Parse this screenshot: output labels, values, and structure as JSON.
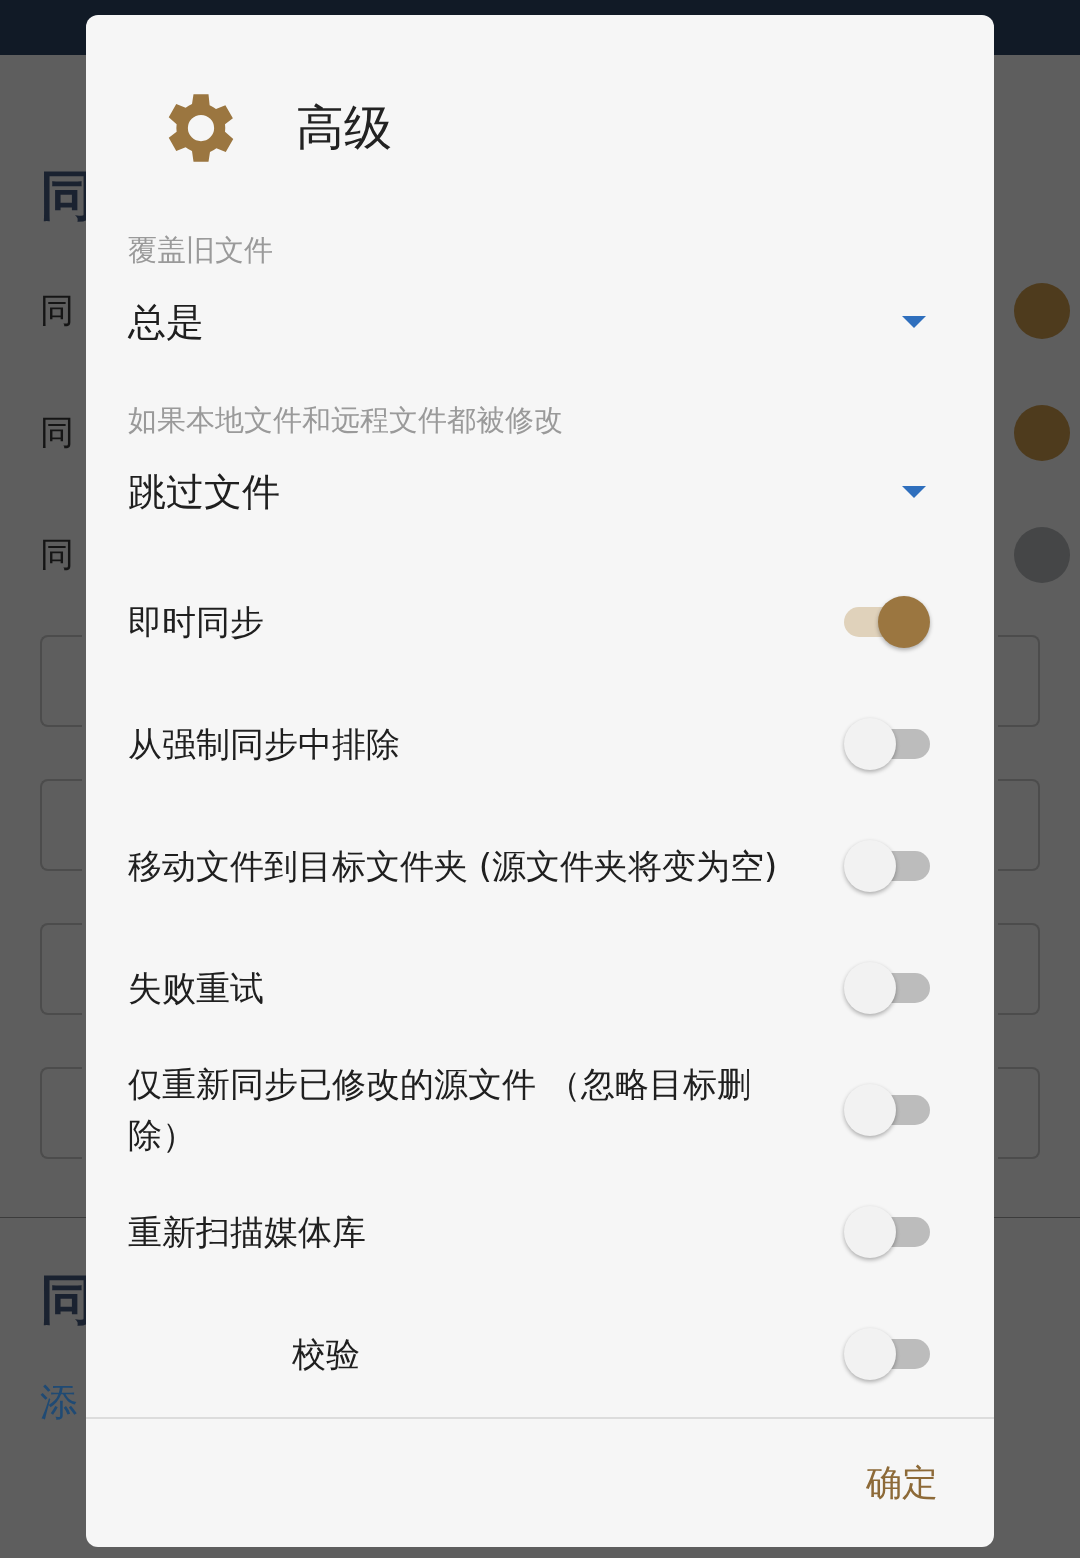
{
  "background": {
    "heading": "同",
    "labels": [
      "同",
      "同",
      "同"
    ],
    "switches": [
      {
        "on": true
      },
      {
        "on": true
      },
      {
        "on": false
      }
    ],
    "footer_heading": "同",
    "link": "添"
  },
  "dialog": {
    "title": "高级",
    "selects": [
      {
        "label": "覆盖旧文件",
        "value": "总是"
      },
      {
        "label": "如果本地文件和远程文件都被修改",
        "value": "跳过文件"
      }
    ],
    "toggles": [
      {
        "kind": "plain",
        "label": "即时同步",
        "on": true
      },
      {
        "kind": "plain",
        "label": "从强制同步中排除",
        "on": false
      },
      {
        "kind": "plain",
        "label": "移动文件到目标文件夹 (源文件夹将变为空)",
        "on": false
      },
      {
        "kind": "plain",
        "label": "失败重试",
        "on": false
      },
      {
        "kind": "plain",
        "label": "仅重新同步已修改的源文件 （忽略目标删除）",
        "on": false
      },
      {
        "kind": "plain",
        "label": "重新扫描媒体库",
        "on": false
      },
      {
        "kind": "indented",
        "label": "校验",
        "on": false
      }
    ],
    "button": "确定"
  }
}
